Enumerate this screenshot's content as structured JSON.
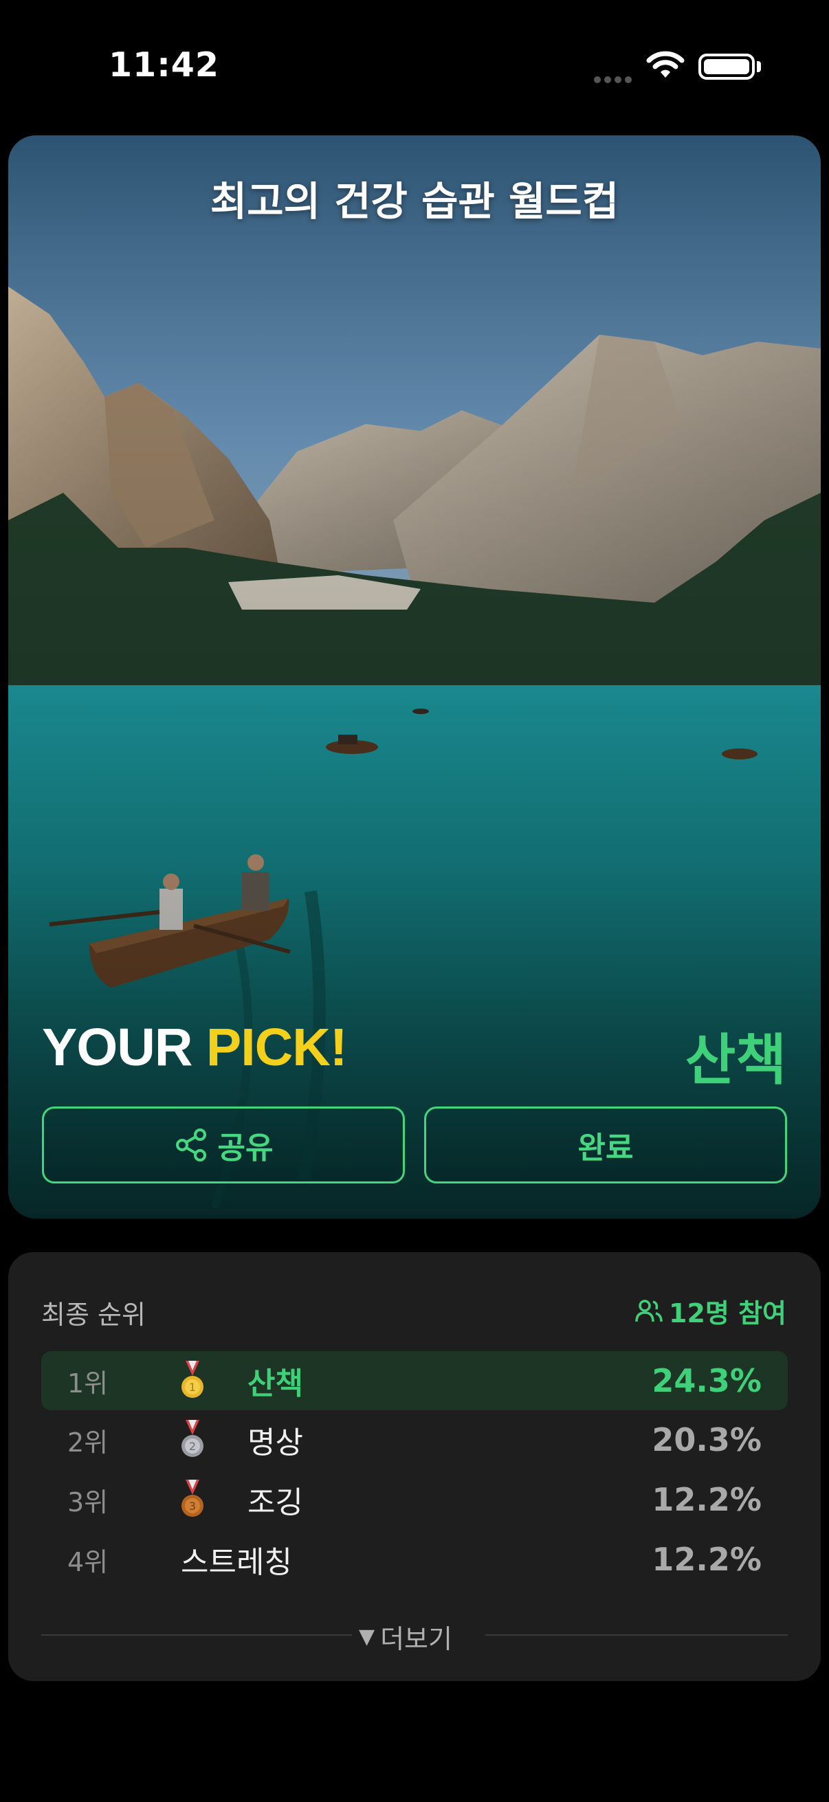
{
  "status_bar": {
    "time": "11:42"
  },
  "result": {
    "title": "최고의 건강 습관 월드컵",
    "pick_prefix": "YOUR",
    "pick_highlight": "PICK!",
    "winner": "산책",
    "share_label": "공유",
    "done_label": "완료"
  },
  "ranking": {
    "heading": "최종 순위",
    "participants": "12명 참여",
    "rows": [
      {
        "rank": "1위",
        "medal": "gold",
        "name": "산책",
        "percent": "24.3%"
      },
      {
        "rank": "2위",
        "medal": "silver",
        "name": "명상",
        "percent": "20.3%"
      },
      {
        "rank": "3위",
        "medal": "bronze",
        "name": "조깅",
        "percent": "12.2%"
      },
      {
        "rank": "4위",
        "medal": "",
        "name": "스트레칭",
        "percent": "12.2%"
      }
    ],
    "more_label": "더보기"
  },
  "colors": {
    "accent_green": "#3fd07a",
    "pick_yellow": "#f3d01c",
    "card_bg": "#1e1e1e"
  },
  "icons": [
    "wifi-icon",
    "battery-icon",
    "share-icon",
    "people-icon",
    "medal-icon",
    "triangle-down-icon"
  ]
}
